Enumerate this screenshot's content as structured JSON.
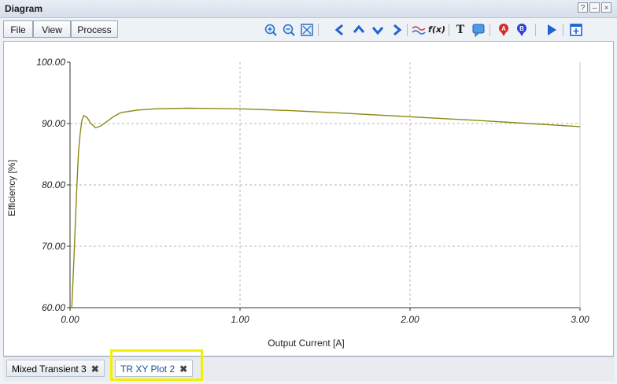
{
  "window": {
    "title": "Diagram",
    "help_label": "?",
    "minimize_label": "–",
    "maximize_label": "□",
    "close_label": "×"
  },
  "menu": {
    "file": "File",
    "view": "View",
    "process": "Process"
  },
  "toolbar": {
    "icons": [
      "zoom-in-icon",
      "zoom-out-icon",
      "zoom-fit-icon",
      "arrow-left-icon",
      "arrow-up-icon",
      "arrow-down-icon",
      "arrow-right-icon",
      "waveform-icon",
      "function-icon",
      "text-icon",
      "comment-icon",
      "marker-a-icon",
      "marker-b-icon",
      "play-icon",
      "add-panel-icon"
    ],
    "function_label": "f(x)",
    "text_label": "T",
    "marker_a_label": "A",
    "marker_b_label": "B"
  },
  "chart_data": {
    "type": "line",
    "xlabel": "Output Current [A]",
    "ylabel": "Efficiency [%]",
    "xlim": [
      0,
      3
    ],
    "ylim": [
      60,
      100
    ],
    "x_ticks": [
      "0.00",
      "1.00",
      "2.00",
      "3.00"
    ],
    "y_ticks": [
      "60.00",
      "70.00",
      "80.00",
      "90.00",
      "100.00"
    ],
    "grid": true,
    "line_color": "#8a8a14",
    "series": [
      {
        "x": [
          0.01,
          0.02,
          0.03,
          0.04,
          0.05,
          0.06,
          0.07,
          0.08,
          0.1,
          0.12,
          0.15,
          0.18,
          0.22,
          0.26,
          0.3,
          0.4,
          0.5,
          0.7,
          1.0,
          1.3,
          1.6,
          2.0,
          2.4,
          2.7,
          3.0
        ],
        "y": [
          60.0,
          66.0,
          73.0,
          79.5,
          85.5,
          88.5,
          90.5,
          91.3,
          91.0,
          90.1,
          89.3,
          89.6,
          90.4,
          91.2,
          91.8,
          92.2,
          92.4,
          92.5,
          92.4,
          92.1,
          91.7,
          91.1,
          90.5,
          90.0,
          89.5
        ]
      }
    ]
  },
  "tabs": [
    {
      "label": "Mixed Transient 3",
      "close": "✖"
    },
    {
      "label": "TR XY Plot 2",
      "close": "✖"
    }
  ]
}
